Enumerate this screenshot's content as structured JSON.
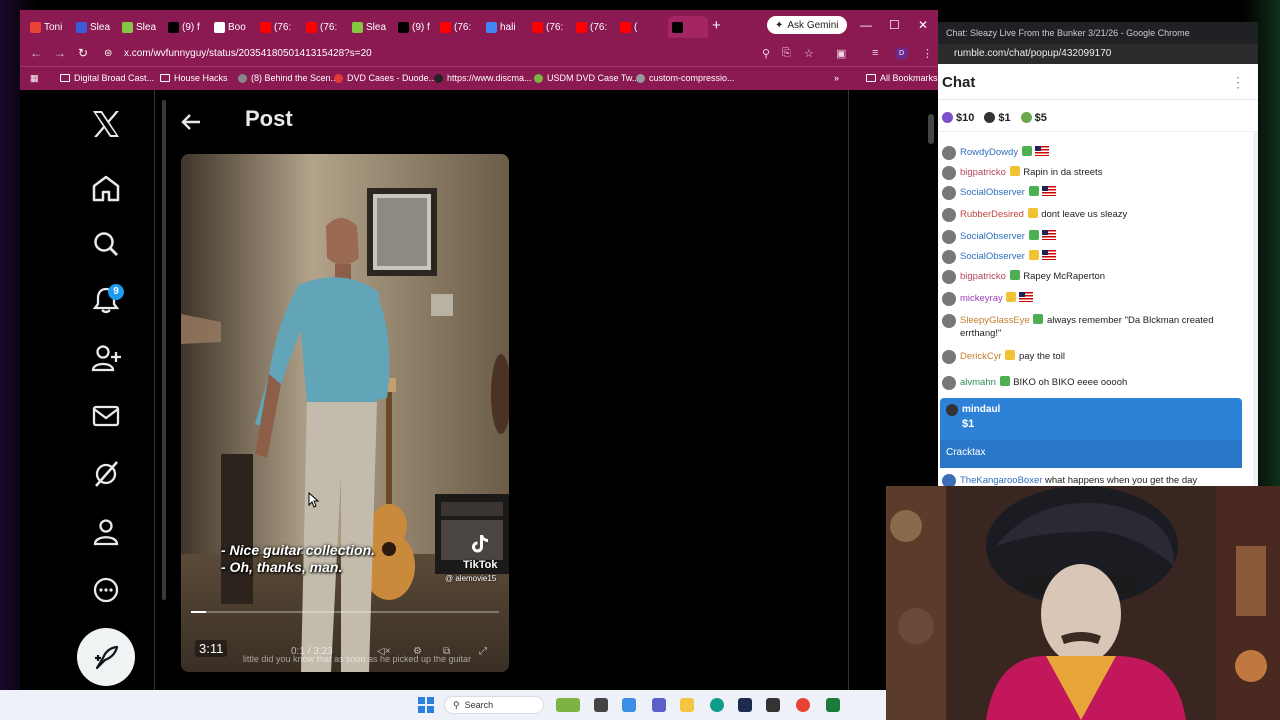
{
  "browser": {
    "tabs": [
      {
        "label": "Toni",
        "color": "#ea4335"
      },
      {
        "label": "Slea",
        "color": "#3b5bdb"
      },
      {
        "label": "Slea",
        "color": "#85c742"
      },
      {
        "label": "(9) f",
        "color": "#000000"
      },
      {
        "label": "Boo",
        "color": "#ffffff"
      },
      {
        "label": "(76:",
        "color": "#ff0000"
      },
      {
        "label": "(76:",
        "color": "#ff0000"
      },
      {
        "label": "Slea",
        "color": "#85c742"
      },
      {
        "label": "(9) f",
        "color": "#000000"
      },
      {
        "label": "(76:",
        "color": "#ff0000"
      },
      {
        "label": "hali",
        "color": "#4285f4"
      },
      {
        "label": "(76:",
        "color": "#ff0000"
      },
      {
        "label": "(76:",
        "color": "#ff0000"
      },
      {
        "label": "(",
        "color": "#ff0000"
      },
      {
        "label": "",
        "color": "#000000"
      }
    ],
    "ask_gemini": "Ask Gemini",
    "url": "x.com/wvfunnyguy/status/2035418050141315428?s=20",
    "bookmarks": [
      "Digital Broad Cast...",
      "House Hacks",
      "(8) Behind the Scen...",
      "DVD Cases - Duode...",
      "https://www.discma...",
      "USDM DVD Case Tw...",
      "custom-compressio..."
    ],
    "all_bookmarks": "All Bookmarks"
  },
  "x": {
    "notifications_count": "9",
    "post_header": "Post",
    "video": {
      "caption_line1": "- Nice guitar collection.",
      "caption_line2": "- Oh, thanks, man.",
      "tiktok_label": "TikTok",
      "tiktok_handle": "@ alemovie15",
      "duration": "3:11",
      "time_readout": "0:1 / 3:23",
      "faded_subtitle": "little did you know that as soon as he picked up the guitar",
      "progress": 0.05
    }
  },
  "popup": {
    "window_title": "Chat: Sleazy Live From the Bunker 3/21/26 - Google Chrome",
    "url": "rumble.com/chat/popup/432099170",
    "chat_title": "Chat",
    "rant_amounts": [
      "$10",
      "$1",
      "$5"
    ],
    "messages": [
      {
        "user": "RowdyDowdy",
        "text": "",
        "color": "#2f6fbf"
      },
      {
        "user": "bigpatricko",
        "text": "Rapin in da streets",
        "color": "#b3455c"
      },
      {
        "user": "SocialObserver",
        "text": "",
        "color": "#2f6fbf"
      },
      {
        "user": "RubberDesired",
        "text": "dont leave us sleazy",
        "color": "#c2473d"
      },
      {
        "user": "SocialObserver",
        "text": "",
        "color": "#2f6fbf"
      },
      {
        "user": "SocialObserver",
        "text": "",
        "color": "#2f6fbf"
      },
      {
        "user": "bigpatricko",
        "text": "Rapey McRaperton",
        "color": "#b3455c"
      },
      {
        "user": "mickeyray",
        "text": "",
        "color": "#a03cbf"
      },
      {
        "user": "SleepyGlassEye",
        "text": "always remember \"Da Blckman created errthang!\"",
        "color": "#c47d2b"
      },
      {
        "user": "DerickCyr",
        "text": "pay the toll",
        "color": "#c47d2b"
      },
      {
        "user": "alvmahn",
        "text": "BIKO oh BIKO eeee ooooh",
        "color": "#2e8b57"
      }
    ],
    "highlight": {
      "user": "mindaul",
      "amount": "$1",
      "text": "Cracktax"
    },
    "last_message": {
      "user": "TheKangarooBoxer",
      "text": "what happens when you get the day"
    }
  },
  "taskbar": {
    "search_label": "Search"
  }
}
